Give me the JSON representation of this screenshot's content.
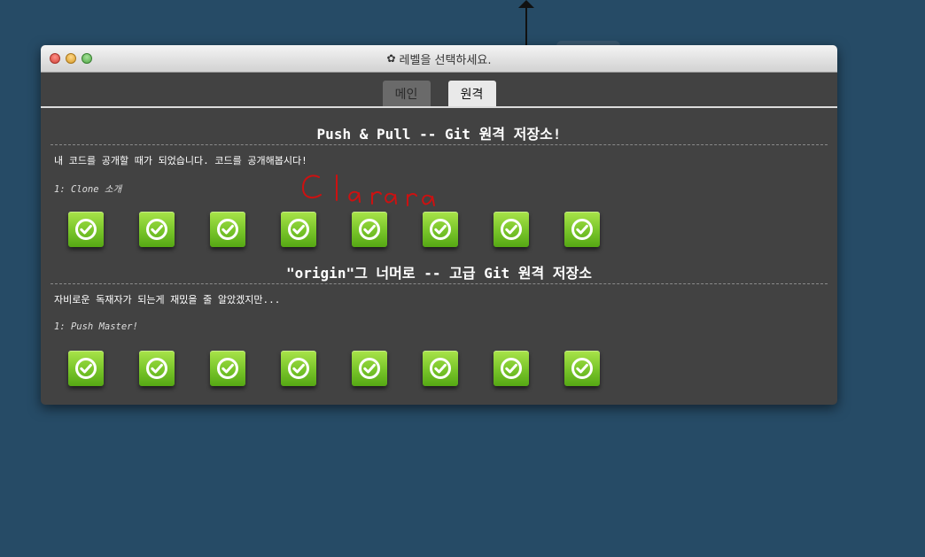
{
  "window": {
    "title": "레벨을 선택하세요.",
    "title_icon": "gear-icon"
  },
  "tabs": [
    {
      "label": "메인",
      "active": false
    },
    {
      "label": "원격",
      "active": true
    }
  ],
  "sections": [
    {
      "title": "Push & Pull -- Git 원격 저장소!",
      "description": "내 코드를 공개할 때가 되었습니다. 코드를 공개해봅시다!",
      "level_label": "1: Clone 소개",
      "level_count": 8,
      "level_status": "completed"
    },
    {
      "title": "\"origin\"그 너머로 -- 고급 Git 원격 저장소",
      "description": "자비로운 독재자가 되는게 재밌을 줄 알았겠지만...",
      "level_label": "1: Push Master!",
      "level_count": 8,
      "level_status": "completed"
    }
  ],
  "signature": "Clarara",
  "colors": {
    "desktop": "#264b66",
    "panel": "#424242",
    "level_green": "#7cc72c",
    "signature_red": "#cc1111"
  }
}
